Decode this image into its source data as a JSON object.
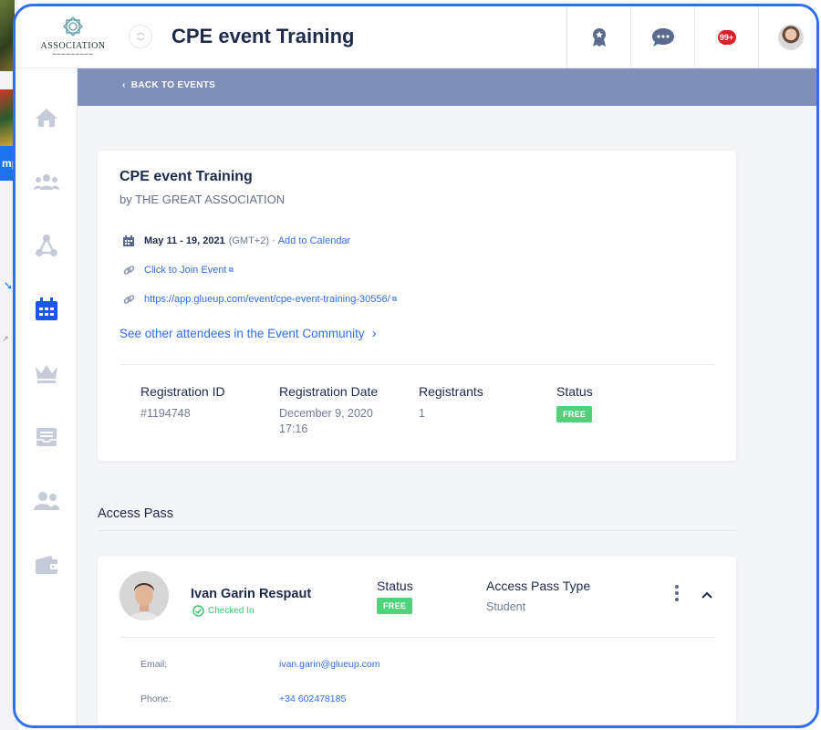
{
  "background": {
    "partial_label": "mp"
  },
  "header": {
    "logo_text": "ASSOCIATION",
    "title": "CPE event Training",
    "icons": [
      "award-icon",
      "chat-icon",
      "notifications-icon",
      "user-avatar"
    ],
    "notification_count": "99+"
  },
  "sidebar": {
    "items": [
      "home-icon",
      "groups-icon",
      "network-icon",
      "calendar-icon",
      "crown-icon",
      "inbox-icon",
      "members-icon",
      "wallet-icon"
    ],
    "active": "calendar-icon"
  },
  "subbar": {
    "back_label": "BACK TO EVENTS"
  },
  "event": {
    "title": "CPE event Training",
    "by_line": "by THE GREAT ASSOCIATION",
    "date": "May 11 - 19, 2021",
    "timezone": "(GMT+2) ·",
    "add_calendar": "Add to Calendar",
    "join_label": "Click to Join Event",
    "url": "https://app.glueup.com/event/cpe-event-training-30556/",
    "community_link": "See other attendees in the Event Community"
  },
  "registration": {
    "id_label": "Registration ID",
    "id_value": "#1194748",
    "date_label": "Registration Date",
    "date_line1": "December 9, 2020",
    "date_line2": "17:16",
    "registrants_label": "Registrants",
    "registrants_value": "1",
    "status_label": "Status",
    "status_value": "FREE"
  },
  "access_pass": {
    "section_title": "Access Pass",
    "name": "Ivan Garin Respaut",
    "checked_in": "Checked In",
    "status_label": "Status",
    "status_value": "FREE",
    "type_label": "Access Pass Type",
    "type_value": "Student",
    "email_label": "Email:",
    "email_value": "ivan.garin@glueup.com",
    "phone_label": "Phone:",
    "phone_value": "+34 602478185"
  },
  "colors": {
    "frame": "#2f6ff0",
    "subbar": "#7f8fb9",
    "link": "#2f6fe8",
    "free_badge": "#4ed37d",
    "active_icon": "#1a56e8",
    "notification": "#e11d2a"
  }
}
